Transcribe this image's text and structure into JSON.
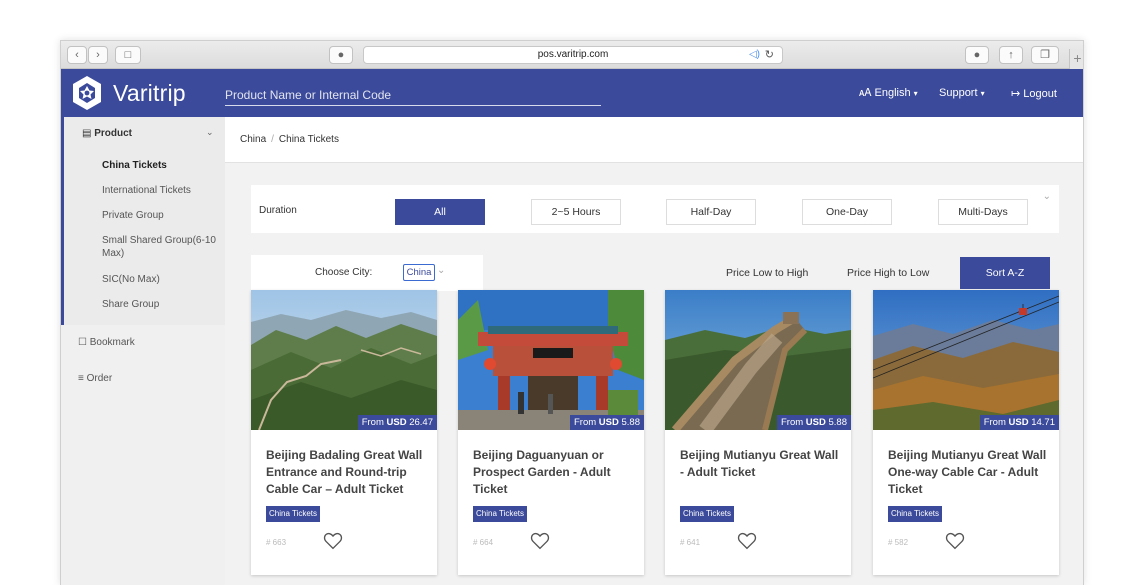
{
  "browser": {
    "url": "pos.varitrip.com",
    "icons": [
      "back-icon",
      "forward-icon",
      "sidebar-icon",
      "shield-icon",
      "audio-icon",
      "reload-icon",
      "download-icon",
      "share-icon",
      "tabs-icon",
      "new-tab-icon"
    ]
  },
  "header": {
    "brand": "Varitrip",
    "search_placeholder": "Product Name or Internal Code",
    "language": "English",
    "support": "Support",
    "logout": "Logout",
    "color": "#3b4a9a"
  },
  "sidebar": {
    "product_label": "Product",
    "subitems": [
      {
        "label": "China Tickets",
        "active": true
      },
      {
        "label": "International Tickets"
      },
      {
        "label": "Private Group"
      },
      {
        "label": "Small Shared Group(6-10 Max)"
      },
      {
        "label": "SIC(No Max)"
      },
      {
        "label": "Share Group"
      }
    ],
    "bookmark": "Bookmark",
    "order": "Order"
  },
  "breadcrumb": {
    "first": "China",
    "sep": "/",
    "second": "China Tickets"
  },
  "filter": {
    "label": "Duration",
    "options": [
      "All",
      "2~5 Hours",
      "Half-Day",
      "One-Day",
      "Multi-Days"
    ],
    "active": "All"
  },
  "city": {
    "label": "Choose City:",
    "value": "China"
  },
  "sort": {
    "low_high": "Price Low to High",
    "high_low": "Price High to Low",
    "az": "Sort A-Z"
  },
  "products": [
    {
      "title": "Beijing Badaling Great Wall Entrance and Round-trip Cable Car – Adult Ticket",
      "price_prefix": "From ",
      "currency": "USD",
      "price": "26.47",
      "tag": "China Tickets",
      "code": "# 663"
    },
    {
      "title": "Beijing Daguanyuan or Prospect Garden - Adult Ticket",
      "price_prefix": "From ",
      "currency": "USD",
      "price": "5.88",
      "tag": "China Tickets",
      "code": "# 664"
    },
    {
      "title": "Beijing Mutianyu Great Wall - Adult Ticket",
      "price_prefix": "From ",
      "currency": "USD",
      "price": "5.88",
      "tag": "China Tickets",
      "code": "# 641"
    },
    {
      "title": "Beijing Mutianyu Great Wall One-way Cable Car - Adult Ticket",
      "price_prefix": "From ",
      "currency": "USD",
      "price": "14.71",
      "tag": "China Tickets",
      "code": "# 582"
    }
  ]
}
